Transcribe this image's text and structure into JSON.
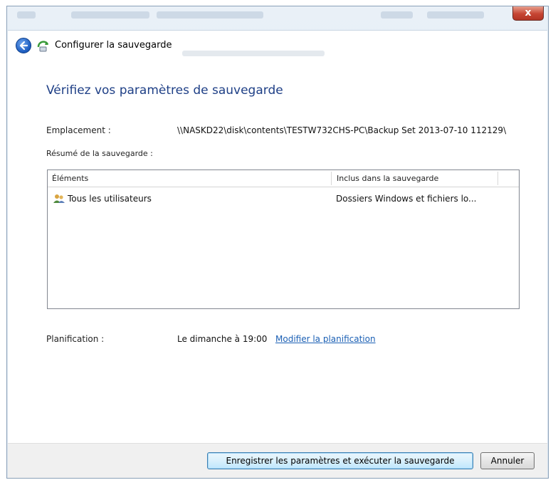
{
  "window": {
    "close_label": "x"
  },
  "navbar": {
    "title": "Configurer la sauvegarde"
  },
  "page": {
    "heading": "Vérifiez vos paramètres de sauvegarde",
    "location_label": "Emplacement :",
    "location_value": "\\\\NASKD22\\disk\\contents\\TESTW732CHS-PC\\Backup Set 2013-07-10 112129\\",
    "summary_label": "Résumé de la sauvegarde :",
    "schedule_label": "Planification :",
    "schedule_value": "Le dimanche à 19:00",
    "schedule_link": "Modifier la planification"
  },
  "list": {
    "columns": [
      "Éléments",
      "Inclus dans la sauvegarde"
    ],
    "rows": [
      {
        "item": "Tous les utilisateurs",
        "included": "Dossiers Windows et fichiers lo..."
      }
    ]
  },
  "footer": {
    "save_run_label": "Enregistrer les paramètres et exécuter la sauvegarde",
    "cancel_label": "Annuler"
  },
  "icons": {
    "back": "back-arrow-icon",
    "app": "backup-icon",
    "users": "users-icon"
  },
  "colors": {
    "heading": "#1e3f86",
    "link": "#1a5fb4",
    "close": "#c64533"
  }
}
